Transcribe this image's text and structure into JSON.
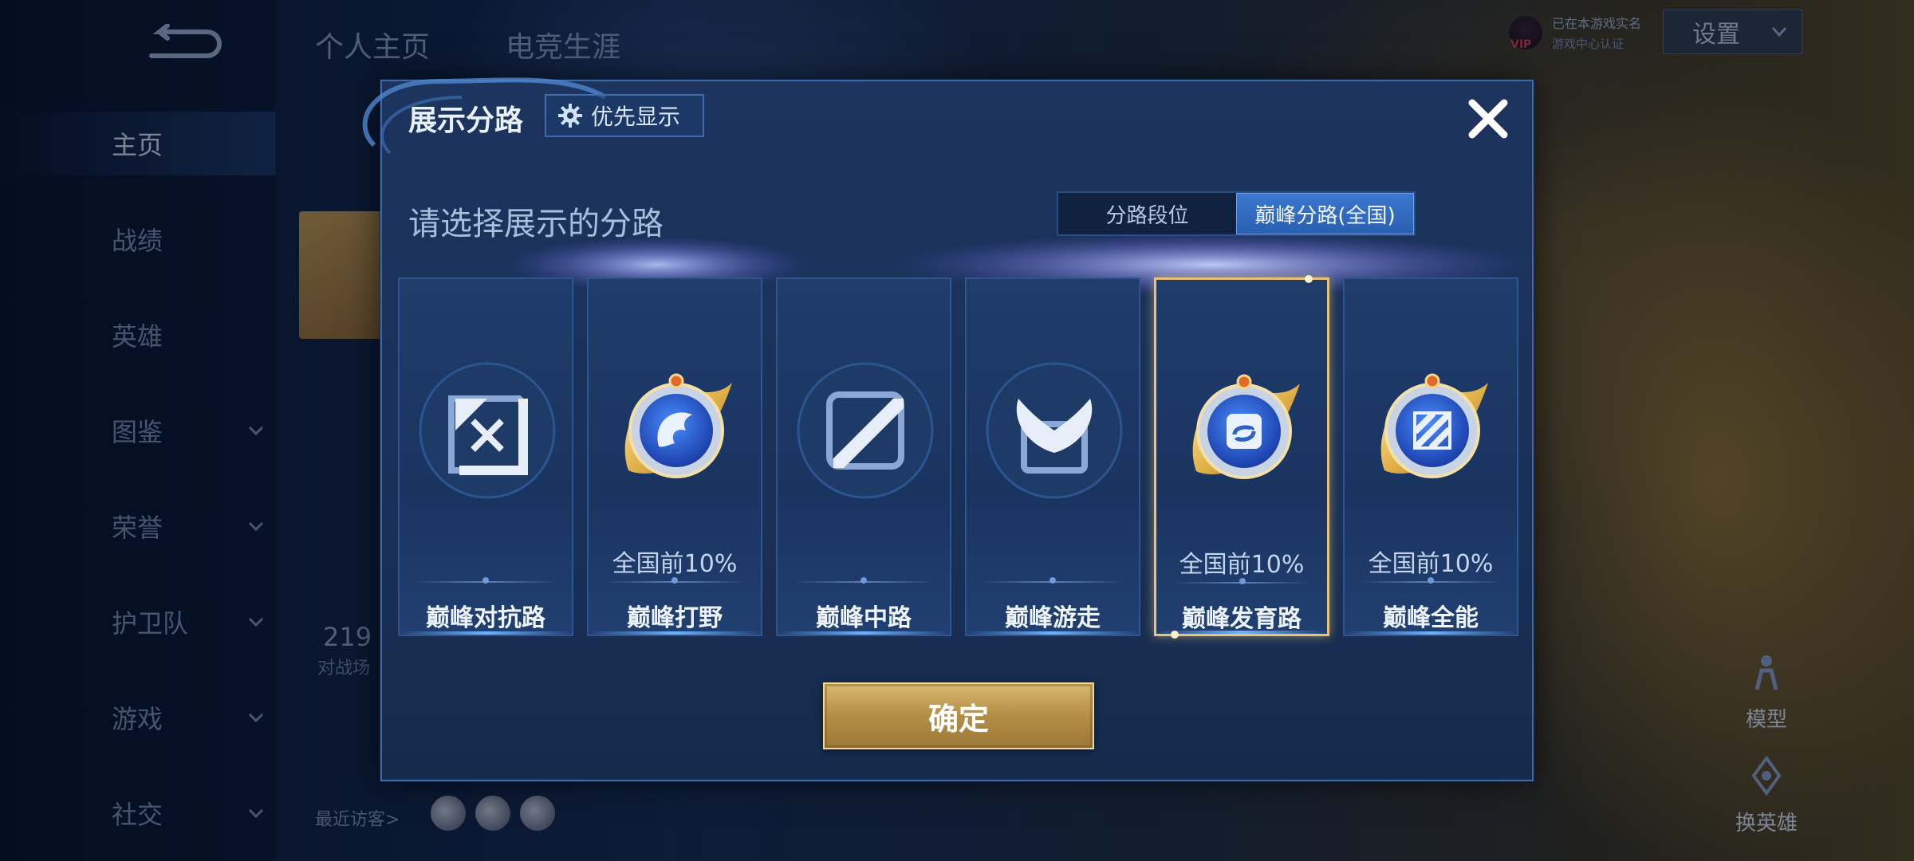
{
  "background": {
    "top_tabs": [
      "个人主页",
      "电竞生涯"
    ],
    "nav": {
      "items": [
        {
          "label": "主页",
          "active": true,
          "has_chevron": false
        },
        {
          "label": "战绩",
          "active": false,
          "has_chevron": false
        },
        {
          "label": "英雄",
          "active": false,
          "has_chevron": false
        },
        {
          "label": "图鉴",
          "active": false,
          "has_chevron": true
        },
        {
          "label": "荣誉",
          "active": false,
          "has_chevron": true
        },
        {
          "label": "护卫队",
          "active": false,
          "has_chevron": true
        },
        {
          "label": "游戏",
          "active": false,
          "has_chevron": true
        },
        {
          "label": "社交",
          "active": false,
          "has_chevron": true
        }
      ]
    },
    "peek_number": "219",
    "peek_sub": "对战场",
    "recent_visitors_label": "最近访客>",
    "status_line1": "已在本游戏实名",
    "status_line2": "游戏中心认证",
    "vip_label": "VIP",
    "settings_label": "设置",
    "right_actions": [
      {
        "label": "模型",
        "icon": "model-icon"
      },
      {
        "label": "换英雄",
        "icon": "swap-hero-icon"
      }
    ]
  },
  "modal": {
    "title": "展示分路",
    "priority_button": "优先显示",
    "subtitle": "请选择展示的分路",
    "toggle": {
      "options": [
        "分路段位",
        "巅峰分路(全国)"
      ],
      "active_index": 1
    },
    "cards": [
      {
        "name": "巅峰对抗路",
        "rank": "",
        "emblem": "clash-lane-emblem",
        "selected": false,
        "decorated": false
      },
      {
        "name": "巅峰打野",
        "rank": "全国前10%",
        "emblem": "jungle-dragon-emblem",
        "selected": false,
        "decorated": true
      },
      {
        "name": "巅峰中路",
        "rank": "",
        "emblem": "mid-lane-emblem",
        "selected": false,
        "decorated": false
      },
      {
        "name": "巅峰游走",
        "rank": "",
        "emblem": "roam-wings-emblem",
        "selected": false,
        "decorated": false
      },
      {
        "name": "巅峰发育路",
        "rank": "全国前10%",
        "emblem": "farm-lane-emblem",
        "selected": true,
        "decorated": true
      },
      {
        "name": "巅峰全能",
        "rank": "全国前10%",
        "emblem": "all-round-emblem",
        "selected": false,
        "decorated": true
      }
    ],
    "confirm_label": "确定"
  },
  "colors": {
    "modal_bg": "#1c345e",
    "accent_blue": "#3a78cf",
    "gold": "#d9b870",
    "selected_border": "#e9c27a"
  }
}
